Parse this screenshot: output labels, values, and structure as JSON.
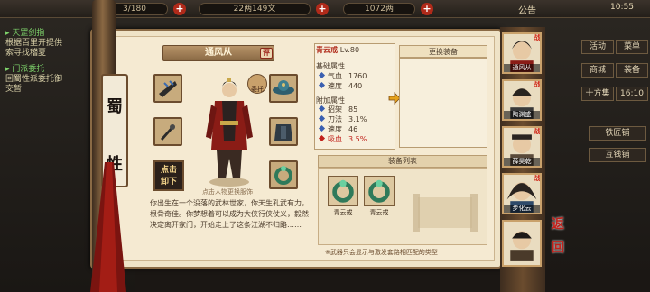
{
  "topbar": {
    "stamina": "3/180",
    "coins": "22两149文",
    "gold": "1072两",
    "announce": "公告",
    "time": "10:55"
  },
  "quests": [
    {
      "title": "天罡剑指",
      "line1": "根据百里开提供",
      "line2": "索寻找稽夏"
    },
    {
      "title": "门派委托",
      "line1": "回蜀性派委托御",
      "line2": "交暂"
    }
  ],
  "right_menu": {
    "items": [
      "活动",
      "菜单",
      "商城",
      "装备",
      "十方集",
      "16:10",
      "铁匠铺",
      "互钱铺"
    ]
  },
  "panel": {
    "faction": [
      "蜀",
      "性"
    ],
    "character_name": "通风从",
    "rate_label": "评",
    "entrust_label": "委托",
    "unequip_label": [
      "点击",
      "卸下"
    ],
    "tip": "点击人物更换服饰",
    "bio": "你出生在一个没落的武林世家，你天生孔武有力，根骨奇佳。你梦想着可以成为大侠行侠仗义，毅然决定离开家门，开始走上了这条江湖不归路……"
  },
  "attributes": {
    "weapon_name": "青云戒",
    "weapon_level": "Lv.80",
    "base_title": "基础属性",
    "base": [
      {
        "label": "气血",
        "value": "1760"
      },
      {
        "label": "速度",
        "value": "440"
      }
    ],
    "extra_title": "附加属性",
    "extra": [
      {
        "label": "招架",
        "value": "85",
        "color": "#3a5fb0"
      },
      {
        "label": "刀法",
        "value": "3.1%",
        "color": "#3a5fb0"
      },
      {
        "label": "速度",
        "value": "46",
        "color": "#3a5fb0"
      },
      {
        "label": "吸血",
        "value": "3.5%",
        "color": "#c0201a"
      }
    ]
  },
  "change_equip": {
    "title": "更换装备"
  },
  "equip_list": {
    "title": "装备列表",
    "items": [
      {
        "name": "青云戒"
      },
      {
        "name": "青云戒"
      }
    ],
    "footnote": "※武器只会显示与激发套路相匹配的类型"
  },
  "roster": [
    {
      "name": "通风从",
      "fight": "战"
    },
    {
      "name": "陶渊盛",
      "fight": "战"
    },
    {
      "name": "薛昊乾",
      "fight": "战"
    },
    {
      "name": "步化云",
      "fight": "战"
    },
    {
      "name": "",
      "fight": ""
    }
  ],
  "return_label": [
    "返",
    "回"
  ],
  "colors": {
    "accent_red": "#b02a1a",
    "parchment": "#f5ead2",
    "wood": "#6b4c2e"
  }
}
